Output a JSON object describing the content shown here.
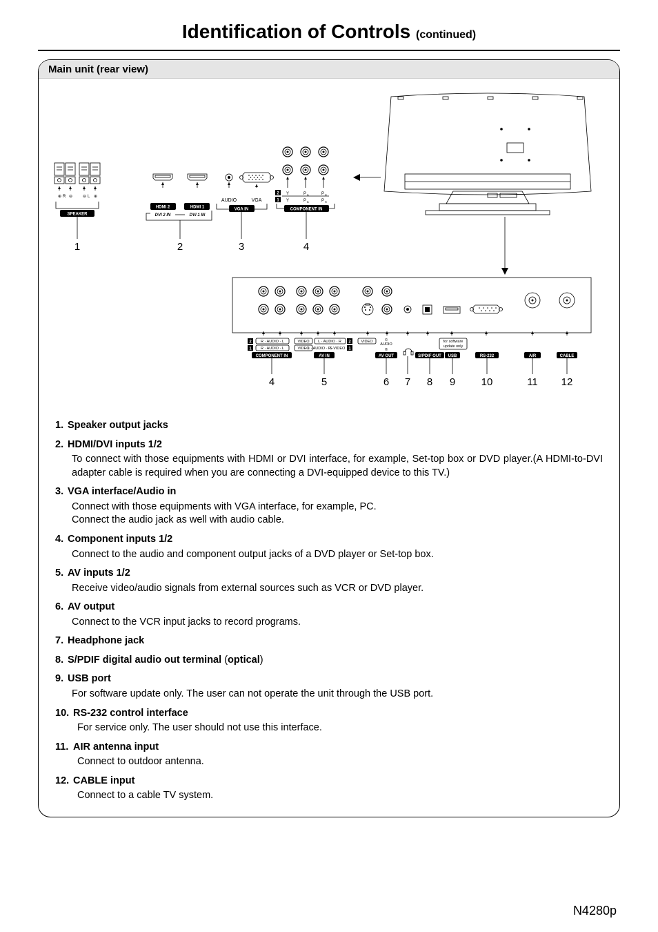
{
  "page": {
    "title_main": "Identification of Controls",
    "title_cont": "(continued)",
    "model": "N4280p"
  },
  "diagram": {
    "section_header": "Main unit (rear view)",
    "top_labels": {
      "speaker": "SPEAKER",
      "r": "R",
      "l": "L",
      "hdmi2": "HDMI 2",
      "hdmi1": "HDMI 1",
      "dvi2in": "DVI 2 IN",
      "dvi1in": "DVI 1 IN",
      "audio": "AUDIO",
      "vga": "VGA",
      "vga_in": "VGA IN",
      "component_in": "COMPONENT IN",
      "y": "Y",
      "pb": "P",
      "pb_sub": "B",
      "pr": "P",
      "pr_sub": "R",
      "comp2": "2",
      "comp1": "1"
    },
    "top_numbers": [
      "1",
      "2",
      "3",
      "4"
    ],
    "bottom_labels": {
      "component_in": "COMPONENT IN",
      "av_in": "AV IN",
      "av_out": "AV OUT",
      "spdif_out": "S/PDIF OUT",
      "usb": "USB",
      "rs232": "RS-232",
      "air": "AIR",
      "cable": "CABLE",
      "video": "VIDEO",
      "raudiol": "R · AUDIO · L",
      "laudior": "L · AUDIO · R",
      "svideo": "S-VIDEO",
      "audio_c": "AUDIO",
      "for_sw": "for software update only",
      "row2": "2",
      "row1": "1"
    },
    "bottom_numbers": [
      "4",
      "5",
      "6",
      "7",
      "8",
      "9",
      "10",
      "11",
      "12"
    ]
  },
  "descriptions": [
    {
      "num": "1",
      "title": "Speaker output jacks",
      "body": ""
    },
    {
      "num": "2",
      "title": "HDMI/DVI inputs 1/2",
      "body": "To connect with those equipments with HDMI or DVI interface, for example, Set-top box or DVD player.(A HDMI-to-DVI adapter cable is required when you are connecting a DVI-equipped device to this TV.)"
    },
    {
      "num": "3",
      "title": "VGA interface/Audio in",
      "body": "Connect with those equipments with VGA interface, for example, PC.\nConnect the audio jack as well with audio cable."
    },
    {
      "num": "4",
      "title": "Component inputs 1/2",
      "body": "Connect to the audio and component output jacks of a DVD player or Set-top box."
    },
    {
      "num": "5",
      "title": "AV inputs 1/2",
      "body": "Receive video/audio signals from external sources such as VCR or DVD player."
    },
    {
      "num": "6",
      "title": "AV output",
      "body": "Connect to the VCR input jacks to record programs."
    },
    {
      "num": "7",
      "title": "Headphone jack",
      "body": ""
    },
    {
      "num": "8",
      "title": "S/PDIF digital audio out terminal (optical)",
      "body": ""
    },
    {
      "num": "9",
      "title": "USB port",
      "body": "For software update only. The user can not operate the unit through the USB port."
    },
    {
      "num": "10",
      "title": "RS-232 control interface",
      "body": "For service only. The user should not use this interface.",
      "wide": true
    },
    {
      "num": "11",
      "title": "AIR antenna input",
      "body": "Connect to outdoor antenna.",
      "wide": true
    },
    {
      "num": "12",
      "title": "CABLE input",
      "body": "Connect to a cable TV system.",
      "wide": true
    }
  ]
}
